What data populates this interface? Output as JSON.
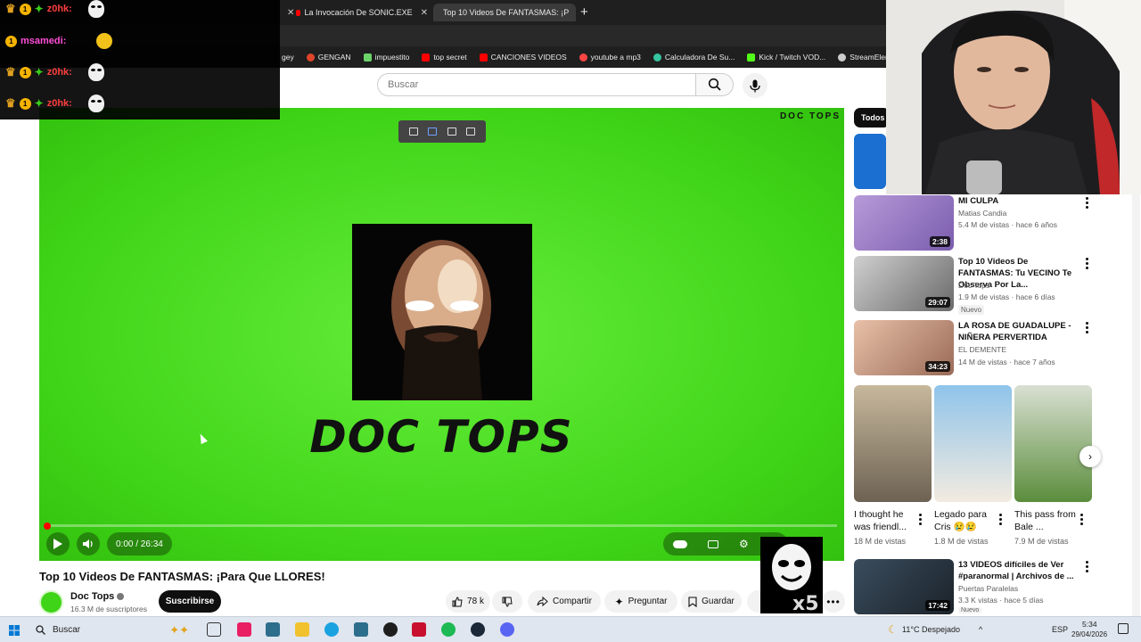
{
  "browser": {
    "tabs": [
      {
        "title": "La Invocación De SONIC.EXE",
        "active": false
      },
      {
        "title": "Top 10 Videos De FANTASMAS: ¡P",
        "active": true
      }
    ],
    "bookmarks": [
      "gey",
      "GENGAN",
      "impuestito",
      "top secret",
      "CANCIONES VIDEOS",
      "youtube a mp3",
      "Calculadora De Su...",
      "Kick / Twitch VOD...",
      "StreamElements"
    ]
  },
  "youtube": {
    "search_placeholder": "Buscar",
    "player": {
      "brand_mark": "DOC TOPS",
      "logo_title": "DOC TOPS",
      "time": "0:00 / 26:34",
      "progress": 0.0
    },
    "video": {
      "title": "Top 10 Videos De FANTASMAS: ¡Para Que LLORES!",
      "channel": "Doc Tops",
      "subscribers": "16.3 M de suscriptores",
      "subscribe_label": "Suscribirse",
      "likes": "78 k",
      "share_label": "Compartir",
      "ask_label": "Preguntar",
      "save_label": "Guardar"
    },
    "sidebar": {
      "chip_all": "Todos",
      "recommendations": [
        {
          "title": "MI CULPA",
          "channel": "Matias Candia",
          "meta": "5.4 M de vistas · hace 6 años",
          "duration": "2:38",
          "badge": ""
        },
        {
          "title": "Top 10 Videos De FANTASMAS: Tu VECINO Te Observa Por La...",
          "channel": "Doc Tops",
          "meta": "1.9 M de vistas · hace 6 días",
          "duration": "29:07",
          "badge": "Nuevo"
        },
        {
          "title": "LA ROSA DE GUADALUPE - NIÑERA PERVERTIDA",
          "channel": "EL DEMENTE",
          "meta": "14 M de vistas · hace 7 años",
          "duration": "34:23",
          "badge": ""
        }
      ],
      "shorts": [
        {
          "title": "I thought he was friendl...",
          "views": "18 M de vistas"
        },
        {
          "title": "Legado para Cris 😢😢",
          "views": "1.8 M de vistas"
        },
        {
          "title": "This pass from Bale ...",
          "views": "7.9 M de vistas"
        }
      ],
      "bottom_rec": {
        "title": "13 VIDEOS difíciles de Ver #paranormal | Archivos de ...",
        "channel": "Puertas Paralelas",
        "meta": "3.3 K vistas · hace 5 días",
        "duration": "17:42",
        "badge": "Nuevo"
      }
    }
  },
  "chat": [
    {
      "user": "z0hk:",
      "color": "red"
    },
    {
      "user": "msamedi:",
      "color": "pink"
    },
    {
      "user": "z0hk:",
      "color": "red"
    },
    {
      "user": "z0hk:",
      "color": "red"
    }
  ],
  "taskbar": {
    "search": "Buscar",
    "weather": "11°C  Despejado",
    "lang": "ESP",
    "time": "5:34",
    "date": "29/04/2026"
  }
}
